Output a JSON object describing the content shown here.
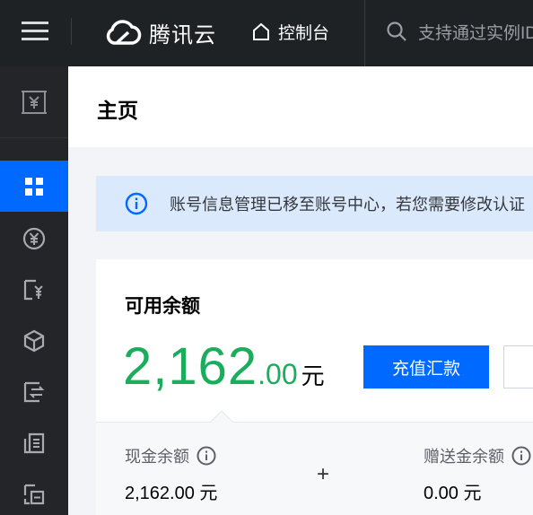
{
  "topbar": {
    "brand": "腾讯云",
    "console_label": "控制台",
    "search_placeholder": "支持通过实例ID"
  },
  "page": {
    "title": "主页"
  },
  "notice": {
    "text": "账号信息管理已移至账号中心，若您需要修改认证"
  },
  "balance_card": {
    "title": "可用余额",
    "amount_int": "2,162",
    "amount_dec": ".00",
    "unit": "元",
    "recharge_label": "充值汇款",
    "cash_label": "现金余额",
    "cash_value": "2,162.00 元",
    "plus": "+",
    "gift_label": "赠送金余额",
    "gift_value": "0.00 元"
  },
  "colors": {
    "accent": "#0069ff",
    "balance_green": "#1aad5c",
    "topbar_bg": "#1f2225",
    "sidebar_bg": "#232528",
    "notice_bg": "#dbe9fc"
  },
  "sidebar": {
    "items": [
      {
        "icon": "overview-grid-icon",
        "active": true
      },
      {
        "icon": "yuan-circle-icon",
        "active": false
      },
      {
        "icon": "invoice-yuan-icon",
        "active": false
      },
      {
        "icon": "cube-icon",
        "active": false
      },
      {
        "icon": "transfer-document-icon",
        "active": false
      },
      {
        "icon": "contract-document-icon",
        "active": false
      },
      {
        "icon": "resource-package-icon",
        "active": false
      }
    ]
  }
}
